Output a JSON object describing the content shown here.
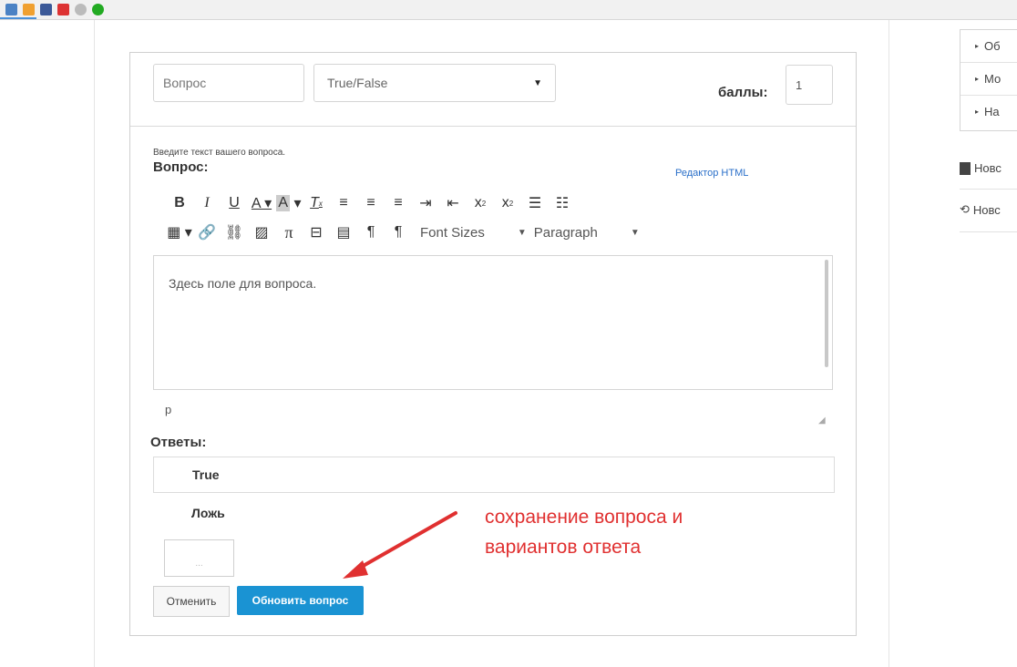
{
  "question_form": {
    "title_placeholder": "Вопрос",
    "type_select": "True/False",
    "points_label": "баллы:",
    "points_value": "1",
    "hint": "Введите текст вашего вопроса.",
    "question_label": "Вопрос:",
    "html_editor_link": "Редактор HTML",
    "toolbar": {
      "font_sizes": "Font Sizes",
      "paragraph": "Paragraph"
    },
    "editor_text": "Здесь поле для вопроса.",
    "status_path": "p",
    "answers_label": "Ответы:",
    "answers": [
      "True",
      "Ложь"
    ],
    "mini_box_text": "...",
    "cancel_button": "Отменить",
    "update_button": "Обновить вопрос"
  },
  "annotation": {
    "line1": "сохранение вопроса и",
    "line2": "вариантов ответа",
    "color": "#e03030"
  },
  "sidebar": {
    "items": [
      "Об",
      "Мо",
      "На"
    ],
    "links": [
      "Новс",
      "Новс"
    ]
  },
  "colors": {
    "primary_button": "#1a93d3",
    "link": "#2a6fc9"
  }
}
